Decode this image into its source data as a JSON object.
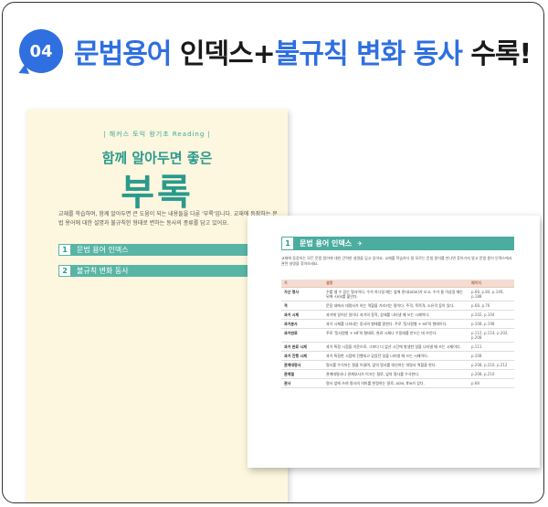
{
  "header": {
    "badge": "04",
    "title_part1": "문법용어",
    "title_part2": " 인덱스+",
    "title_part3": "불규칙 변화 동사",
    "title_part4": " 수록!"
  },
  "book": {
    "series": "| 해커스 토익 왕기초 Reading |",
    "subtitle": "함께 알아두면 좋은",
    "title": "부록",
    "description": "교재를 학습하며, 함께 알아두면 큰 도움이 되는 내용들을 다룬 '부록'입니다. 교재에 등장하는 문법 용어에 대한 설명과 불규칙한 형태로 변하는 동사의 종류를 담고 있어요.",
    "sections": [
      {
        "num": "1",
        "label": "문법 용어 인덱스"
      },
      {
        "num": "2",
        "label": "불규칙 변화 동사"
      }
    ]
  },
  "page": {
    "num": "1",
    "heading": "문법 용어 인덱스",
    "intro": "교재에 등장하는 모든 문법 용어에 대한 간략한 설명을 담고 있어요. 교재를 학습하다 잘 모르는 문법 용어를 만나면 찾아가지 말고 문법 용어 인덱스에서 관련 설명을 찾아보세요.",
    "columns": [
      "가",
      "설명",
      "페이지"
    ],
    "rows": [
      {
        "term": "가산 명사",
        "desc": "수를 셀 수 있는 명사이다. 수가 하나일 때는 앞에 관사(a/an)가 오고, 수가 둘 이상일 때는 뒤에 -(e)s를 붙인다.",
        "pg": "p.68, p.84, p.146, p.188"
      },
      {
        "term": "격",
        "desc": "문장 내에서 대명사가 하는 역할을 가리키는 말이다. 주격, 목적격, 소유격 등이 있다.",
        "pg": "p.68, p.76"
      },
      {
        "term": "과거 시제",
        "desc": "과거에 일어난 일이나 과거의 동작, 상태를 나타낼 때 쓰는 시제이다.",
        "pg": "p.102, p.104"
      },
      {
        "term": "과거분사",
        "desc": "과거 시제를 나타내는 동사의 형태를 말한다. 주로 '동사원형 + ed'의 형태이다.",
        "pg": "p.108, p.198"
      },
      {
        "term": "과거완료",
        "desc": "주로 '동사원형 + ed'의 형태로, 완료 시제나 수동태를 만드는 데 쓰인다.",
        "pg": "p.112, p.114, p.202, p.208"
      },
      {
        "term": "과거 완료 시제",
        "desc": "과거 특정 시점을 기준으로, 그보다 더 앞선 시간에 발생한 일을 나타낼 때 쓰는 시제이다.",
        "pg": "p.111"
      },
      {
        "term": "과거 진행 시제",
        "desc": "과거 특정한 시점에 진행되고 있었던 일을 나타낼 때 쓰는 시제이다.",
        "pg": "p.108"
      },
      {
        "term": "관계대명사",
        "desc": "명사를 수식하는 절을 이끌며, 앞의 명사를 대신하는 대명사 역할을 한다.",
        "pg": "p.208, p.210, p.212"
      },
      {
        "term": "관계절",
        "desc": "관계대명사나 관계부사가 이끄는 절로, 앞의 명사를 수식한다.",
        "pg": "p.208, p.210"
      },
      {
        "term": "관사",
        "desc": "명사 앞에 쓰여 명사의 의미를 한정하는 말로, a/an, the가 있다.",
        "pg": "p.68"
      }
    ]
  }
}
